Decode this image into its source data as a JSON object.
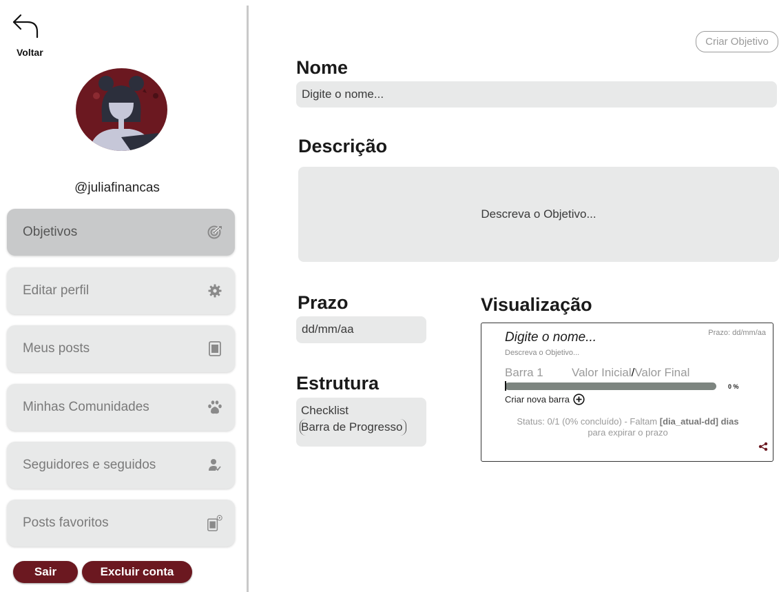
{
  "sidebar": {
    "back_label": "Voltar",
    "username": "@juliafinancas",
    "items": [
      {
        "label": "Objetivos",
        "icon": "target-icon",
        "active": true
      },
      {
        "label": "Editar perfil",
        "icon": "gear-icon",
        "active": false
      },
      {
        "label": "Meus posts",
        "icon": "document-icon",
        "active": false
      },
      {
        "label": "Minhas Comunidades",
        "icon": "paw-icon",
        "active": false
      },
      {
        "label": "Seguidores e seguidos",
        "icon": "user-check-icon",
        "active": false
      },
      {
        "label": "Posts favoritos",
        "icon": "document-star-icon",
        "active": false
      }
    ],
    "logout_label": "Sair",
    "delete_account_label": "Excluir conta"
  },
  "form": {
    "create_button": "Criar Objetivo",
    "name_heading": "Nome",
    "name_placeholder": "Digite o nome...",
    "description_heading": "Descrição",
    "description_placeholder": "Descreva o Objetivo...",
    "deadline_heading": "Prazo",
    "deadline_placeholder": "dd/mm/aa",
    "structure_heading": "Estrutura",
    "structure_options": [
      "Checklist",
      "Barra de Progresso"
    ],
    "structure_selected": "Barra de Progresso"
  },
  "preview": {
    "heading": "Visualização",
    "name": "Digite o nome...",
    "deadline": "Prazo: dd/mm/aa",
    "description": "Descreva o Objetivo...",
    "bar_label": "Barra 1",
    "initial_value": "Valor Inicial",
    "final_value": "Valor Final",
    "progress_percent": "0 %",
    "progress": 0,
    "new_bar_label": "Criar nova barra",
    "status_line1_prefix": "Status: 0/1 (0% concluído) - Faltam ",
    "status_line1_bold": "[dia_atual-dd] dias",
    "status_line2": "para expirar o prazo"
  },
  "colors": {
    "accent": "#6b1820",
    "nav_background": "#e8e9e9",
    "nav_active": "#c8c9ca",
    "progress_track": "#7d8580"
  }
}
